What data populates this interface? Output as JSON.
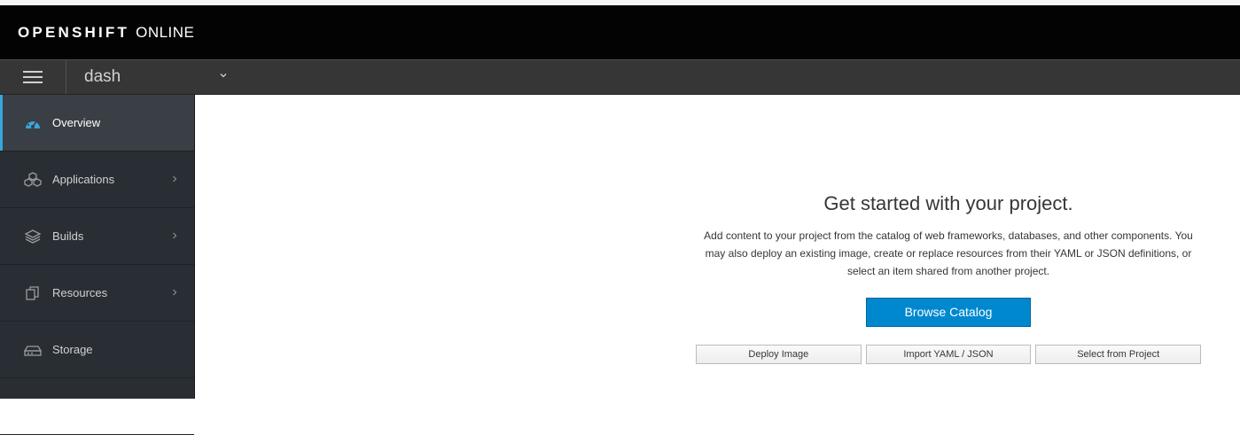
{
  "brand": {
    "name_bold": "OPENSHIFT",
    "name_light": "ONLINE"
  },
  "project_bar": {
    "menu_icon": "hamburger-icon",
    "project": "dash",
    "caret_icon": "chevron-down-icon"
  },
  "sidebar": {
    "items": [
      {
        "label": "Overview",
        "icon": "dashboard-icon",
        "active": true,
        "has_children": false
      },
      {
        "label": "Applications",
        "icon": "cubes-icon",
        "active": false,
        "has_children": true
      },
      {
        "label": "Builds",
        "icon": "layers-icon",
        "active": false,
        "has_children": true
      },
      {
        "label": "Resources",
        "icon": "resources-icon",
        "active": false,
        "has_children": true
      },
      {
        "label": "Storage",
        "icon": "storage-icon",
        "active": false,
        "has_children": false
      }
    ]
  },
  "empty_state": {
    "title": "Get started with your project.",
    "body": "Add content to your project from the catalog of web frameworks, databases, and other components. You may also deploy an existing image, create or replace resources from their YAML or JSON definitions, or select an item shared from another project.",
    "primary_button": "Browse Catalog",
    "secondary_buttons": [
      "Deploy Image",
      "Import YAML / JSON",
      "Select from Project"
    ]
  },
  "colors": {
    "accent": "#39a5dc",
    "primary": "#0088ce",
    "masthead": "#030303",
    "sidebar": "#292e34"
  }
}
